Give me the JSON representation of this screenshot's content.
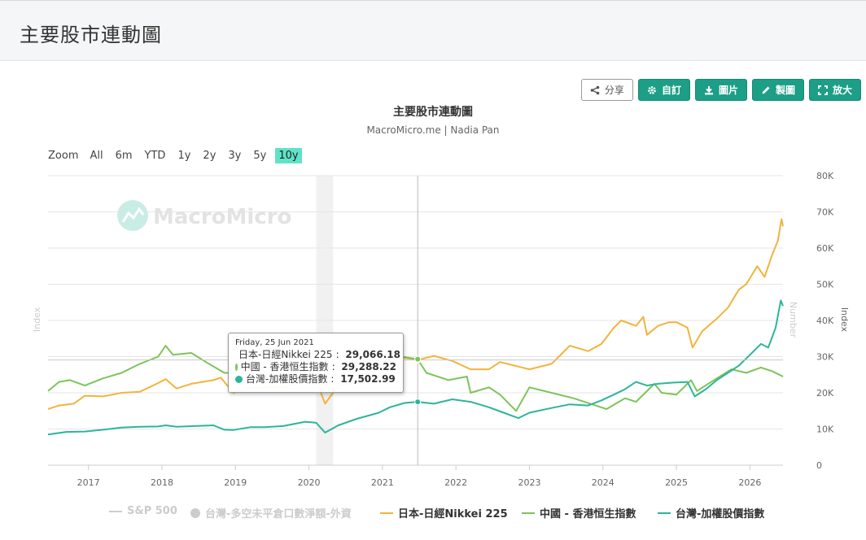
{
  "page": {
    "title": "主要股市連動圖"
  },
  "toolbar": {
    "share": "分享",
    "custom": "自訂",
    "image": "圖片",
    "draw": "製圖",
    "enlarge": "放大"
  },
  "zoom": {
    "label": "Zoom",
    "options": [
      "All",
      "6m",
      "YTD",
      "1y",
      "2y",
      "3y",
      "5y",
      "10y"
    ],
    "selected": "10y"
  },
  "watermark": "MacroMicro",
  "tooltip": {
    "date": "Friday, 25 Jun 2021",
    "rows": [
      {
        "label": "日本-日經Nikkei 225",
        "value": "29,066.18",
        "color": "#f2b33d"
      },
      {
        "label": "中國 - 香港恒生指數",
        "value": "29,288.22",
        "color": "#7cc45a"
      },
      {
        "label": "台灣-加權股價指數",
        "value": "17,502.99",
        "color": "#2cb59a"
      }
    ]
  },
  "legend": {
    "items": [
      {
        "label": "S&P 500",
        "marker": "line",
        "color": "#cccccc",
        "visible": false
      },
      {
        "label": "台灣-多空未平倉口數淨額-外資",
        "marker": "dot",
        "color": "#cccccc",
        "visible": false
      },
      {
        "label": "日本-日經Nikkei 225",
        "marker": "line",
        "color": "#f2b33d",
        "visible": true
      },
      {
        "label": "中國 - 香港恒生指數",
        "marker": "line",
        "color": "#7cc45a",
        "visible": true
      },
      {
        "label": "台灣-加權股價指數",
        "marker": "line",
        "color": "#2cb59a",
        "visible": true
      }
    ]
  },
  "chart_data": {
    "type": "line",
    "title": "主要股市連動圖",
    "subtitle": "MacroMicro.me | Nadia Pan",
    "xlabel": "",
    "x_ticks": [
      "2017",
      "2018",
      "2019",
      "2020",
      "2021",
      "2022",
      "2023",
      "2024",
      "2025",
      "2026"
    ],
    "xlim": [
      2016.45,
      2026.45
    ],
    "y_axes": [
      {
        "position": "left",
        "label": "Index",
        "ticks": [],
        "faded": true
      },
      {
        "position": "right",
        "label": "Number",
        "ticks": [],
        "faded": true
      },
      {
        "position": "right",
        "label": "Index",
        "ticks": [
          "0",
          "10K",
          "20K",
          "30K",
          "40K",
          "50K",
          "60K",
          "70K",
          "80K"
        ],
        "ylim": [
          0,
          80000
        ]
      }
    ],
    "shaded_band": {
      "from": 2020.1,
      "to": 2020.33
    },
    "crosshair_x": 2021.48,
    "grid": true,
    "series": [
      {
        "name": "日本-日經Nikkei 225",
        "color": "#f2b33d",
        "points": [
          [
            2016.45,
            15500
          ],
          [
            2016.6,
            16500
          ],
          [
            2016.8,
            17000
          ],
          [
            2016.95,
            19200
          ],
          [
            2017.2,
            19000
          ],
          [
            2017.45,
            20000
          ],
          [
            2017.7,
            20300
          ],
          [
            2017.95,
            22700
          ],
          [
            2018.05,
            23800
          ],
          [
            2018.2,
            21200
          ],
          [
            2018.4,
            22500
          ],
          [
            2018.7,
            23500
          ],
          [
            2018.8,
            24200
          ],
          [
            2018.97,
            20000
          ],
          [
            2019.2,
            21300
          ],
          [
            2019.5,
            21500
          ],
          [
            2019.7,
            21500
          ],
          [
            2019.95,
            23700
          ],
          [
            2020.1,
            23300
          ],
          [
            2020.22,
            17000
          ],
          [
            2020.4,
            22000
          ],
          [
            2020.65,
            23000
          ],
          [
            2020.9,
            26500
          ],
          [
            2021.0,
            27500
          ],
          [
            2021.12,
            30200
          ],
          [
            2021.48,
            29066
          ],
          [
            2021.7,
            30200
          ],
          [
            2021.95,
            28800
          ],
          [
            2022.2,
            26500
          ],
          [
            2022.45,
            26500
          ],
          [
            2022.6,
            28500
          ],
          [
            2022.8,
            27500
          ],
          [
            2023.0,
            26500
          ],
          [
            2023.3,
            28000
          ],
          [
            2023.45,
            31000
          ],
          [
            2023.55,
            33000
          ],
          [
            2023.8,
            31500
          ],
          [
            2023.98,
            33500
          ],
          [
            2024.15,
            38000
          ],
          [
            2024.25,
            40000
          ],
          [
            2024.45,
            38500
          ],
          [
            2024.55,
            41000
          ],
          [
            2024.6,
            36000
          ],
          [
            2024.75,
            38500
          ],
          [
            2024.9,
            39500
          ],
          [
            2025.0,
            39500
          ],
          [
            2025.15,
            38000
          ],
          [
            2025.22,
            32500
          ],
          [
            2025.35,
            37000
          ],
          [
            2025.55,
            40500
          ],
          [
            2025.7,
            43500
          ],
          [
            2025.85,
            48500
          ],
          [
            2025.95,
            50000
          ],
          [
            2026.1,
            55000
          ],
          [
            2026.2,
            52000
          ],
          [
            2026.3,
            58000
          ],
          [
            2026.38,
            62000
          ],
          [
            2026.43,
            68000
          ],
          [
            2026.45,
            66000
          ]
        ]
      },
      {
        "name": "中國 - 香港恒生指數",
        "color": "#7cc45a",
        "points": [
          [
            2016.45,
            20500
          ],
          [
            2016.6,
            23000
          ],
          [
            2016.75,
            23500
          ],
          [
            2016.95,
            22000
          ],
          [
            2017.2,
            24000
          ],
          [
            2017.45,
            25500
          ],
          [
            2017.7,
            28000
          ],
          [
            2017.95,
            30000
          ],
          [
            2018.05,
            33000
          ],
          [
            2018.15,
            30500
          ],
          [
            2018.4,
            31000
          ],
          [
            2018.6,
            28500
          ],
          [
            2018.85,
            25500
          ],
          [
            2018.97,
            25500
          ],
          [
            2019.2,
            29500
          ],
          [
            2019.35,
            30000
          ],
          [
            2019.55,
            28000
          ],
          [
            2019.7,
            26000
          ],
          [
            2019.95,
            28500
          ],
          [
            2020.1,
            28000
          ],
          [
            2020.22,
            22000
          ],
          [
            2020.4,
            24500
          ],
          [
            2020.6,
            25500
          ],
          [
            2020.85,
            25000
          ],
          [
            2020.98,
            27000
          ],
          [
            2021.12,
            30500
          ],
          [
            2021.48,
            29288
          ],
          [
            2021.6,
            25500
          ],
          [
            2021.9,
            23500
          ],
          [
            2022.15,
            24500
          ],
          [
            2022.2,
            20000
          ],
          [
            2022.45,
            21500
          ],
          [
            2022.6,
            19500
          ],
          [
            2022.82,
            15000
          ],
          [
            2023.0,
            21500
          ],
          [
            2023.3,
            20000
          ],
          [
            2023.6,
            18500
          ],
          [
            2023.9,
            16500
          ],
          [
            2024.05,
            15500
          ],
          [
            2024.3,
            18500
          ],
          [
            2024.45,
            17500
          ],
          [
            2024.7,
            22500
          ],
          [
            2024.8,
            20000
          ],
          [
            2025.0,
            19500
          ],
          [
            2025.2,
            23500
          ],
          [
            2025.28,
            20500
          ],
          [
            2025.55,
            24000
          ],
          [
            2025.75,
            26500
          ],
          [
            2025.95,
            25500
          ],
          [
            2026.15,
            27000
          ],
          [
            2026.3,
            26000
          ],
          [
            2026.45,
            24500
          ]
        ]
      },
      {
        "name": "台灣-加權股價指數",
        "color": "#2cb59a",
        "points": [
          [
            2016.45,
            8500
          ],
          [
            2016.7,
            9200
          ],
          [
            2016.95,
            9300
          ],
          [
            2017.2,
            9800
          ],
          [
            2017.45,
            10400
          ],
          [
            2017.7,
            10600
          ],
          [
            2017.95,
            10700
          ],
          [
            2018.05,
            11000
          ],
          [
            2018.2,
            10600
          ],
          [
            2018.45,
            10800
          ],
          [
            2018.7,
            11000
          ],
          [
            2018.85,
            9800
          ],
          [
            2018.97,
            9700
          ],
          [
            2019.2,
            10500
          ],
          [
            2019.4,
            10500
          ],
          [
            2019.65,
            10800
          ],
          [
            2019.95,
            12000
          ],
          [
            2020.1,
            11700
          ],
          [
            2020.22,
            9000
          ],
          [
            2020.4,
            11000
          ],
          [
            2020.65,
            12800
          ],
          [
            2020.95,
            14500
          ],
          [
            2021.1,
            16000
          ],
          [
            2021.3,
            17200
          ],
          [
            2021.48,
            17503
          ],
          [
            2021.7,
            17000
          ],
          [
            2021.95,
            18200
          ],
          [
            2022.2,
            17500
          ],
          [
            2022.45,
            16000
          ],
          [
            2022.65,
            14500
          ],
          [
            2022.85,
            13000
          ],
          [
            2023.0,
            14500
          ],
          [
            2023.3,
            15800
          ],
          [
            2023.55,
            16800
          ],
          [
            2023.8,
            16500
          ],
          [
            2023.98,
            17900
          ],
          [
            2024.15,
            19500
          ],
          [
            2024.3,
            21000
          ],
          [
            2024.45,
            23000
          ],
          [
            2024.6,
            22000
          ],
          [
            2024.75,
            22500
          ],
          [
            2024.95,
            22800
          ],
          [
            2025.15,
            23000
          ],
          [
            2025.25,
            19000
          ],
          [
            2025.4,
            21000
          ],
          [
            2025.55,
            23500
          ],
          [
            2025.7,
            25500
          ],
          [
            2025.85,
            27500
          ],
          [
            2026.0,
            30500
          ],
          [
            2026.15,
            33500
          ],
          [
            2026.25,
            32500
          ],
          [
            2026.35,
            38000
          ],
          [
            2026.42,
            45500
          ],
          [
            2026.45,
            44000
          ]
        ]
      }
    ]
  }
}
